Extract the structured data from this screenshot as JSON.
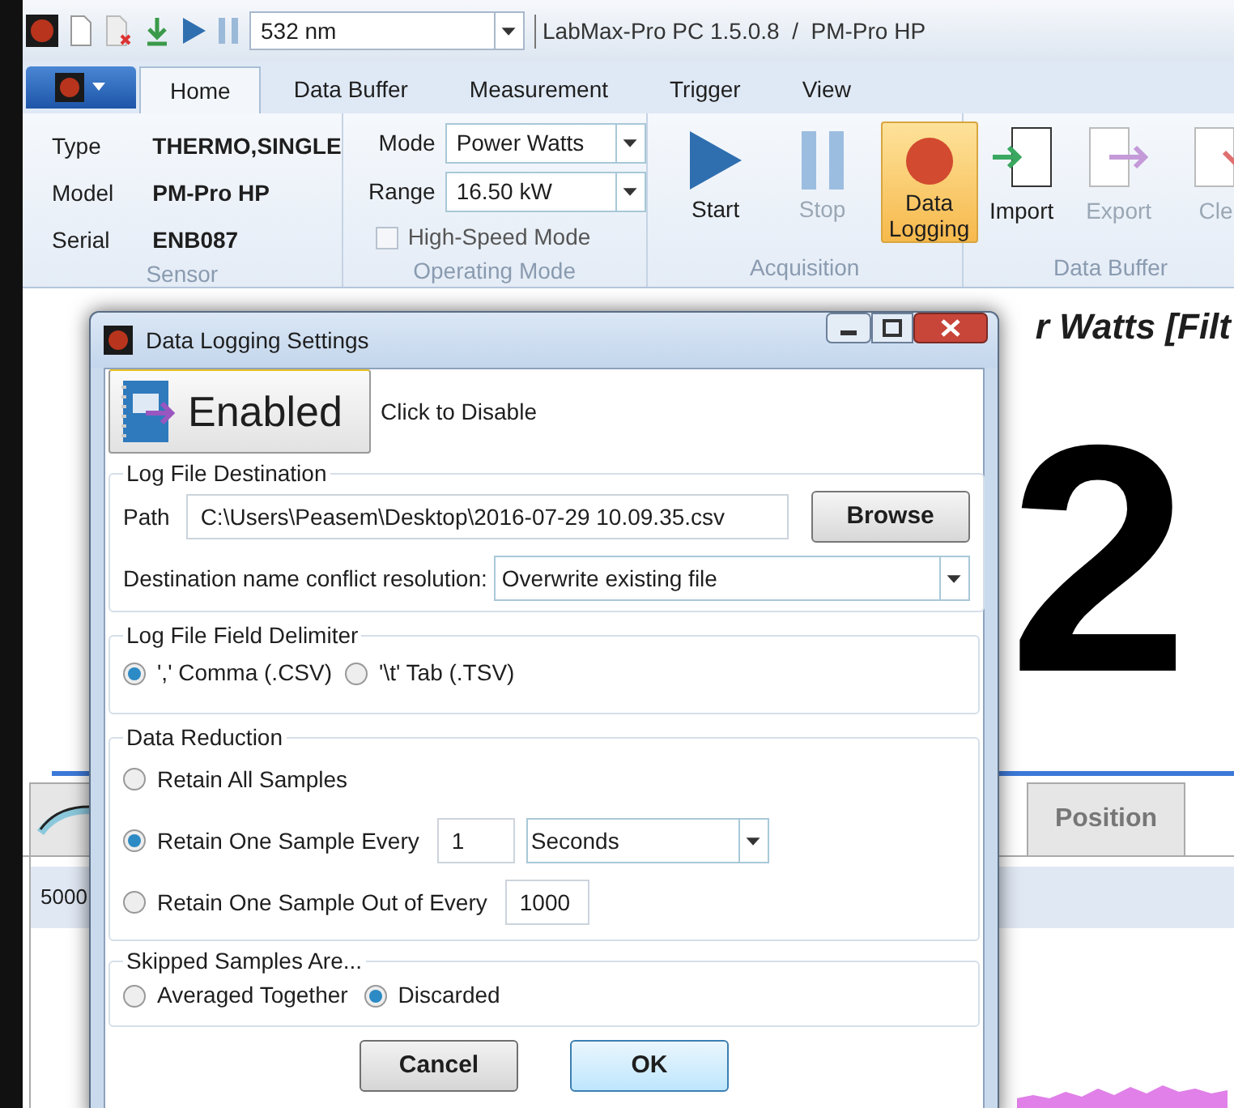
{
  "quick_access": {
    "wavelength": "532 nm"
  },
  "window": {
    "title": "LabMax-Pro PC 1.5.0.8  /  PM-Pro HP"
  },
  "tabs": [
    {
      "label": "Home",
      "selected": true
    },
    {
      "label": "Data Buffer",
      "selected": false
    },
    {
      "label": "Measurement",
      "selected": false
    },
    {
      "label": "Trigger",
      "selected": false
    },
    {
      "label": "View",
      "selected": false
    }
  ],
  "sensor": {
    "caption": "Sensor",
    "fields": [
      {
        "label": "Type",
        "value": "THERMO,SINGLE"
      },
      {
        "label": "Model",
        "value": "PM-Pro HP"
      },
      {
        "label": "Serial",
        "value": "ENB087"
      }
    ]
  },
  "operating_mode": {
    "caption": "Operating Mode",
    "selects": [
      {
        "label": "Mode",
        "value": "Power Watts"
      },
      {
        "label": "Range",
        "value": "16.50 kW"
      }
    ],
    "high_speed": {
      "label": "High-Speed Mode",
      "checked": false
    }
  },
  "acquisition": {
    "caption": "Acquisition",
    "buttons": [
      {
        "kind": "start",
        "label": "Start",
        "disabled": false,
        "selected": false
      },
      {
        "kind": "stop",
        "label": "Stop",
        "disabled": true,
        "selected": false
      },
      {
        "kind": "record",
        "label": "Data Logging",
        "disabled": false,
        "selected": true
      }
    ]
  },
  "data_buffer": {
    "caption": "Data Buffer",
    "buttons": [
      {
        "kind": "import",
        "label": "Import",
        "disabled": false
      },
      {
        "kind": "export",
        "label": "Export",
        "disabled": true
      },
      {
        "kind": "clear",
        "label": "Cle",
        "disabled": true
      }
    ]
  },
  "display": {
    "heading": "r Watts [Filt",
    "reading": "2",
    "bottom_tabs": [
      {
        "kind": "icon",
        "selected": false
      },
      {
        "kind": "text",
        "label": "Position",
        "selected": false
      }
    ],
    "chart_label": "5000"
  },
  "dialog": {
    "title": "Data Logging Settings",
    "toggle": {
      "label": "Enabled",
      "on": true,
      "hint": "Click to Disable"
    },
    "destination": {
      "legend": "Log File Destination",
      "path_label": "Path",
      "path": "C:\\Users\\Peasem\\Desktop\\2016-07-29 10.09.35.csv",
      "browse": "Browse",
      "conflict_label": "Destination name conflict resolution:",
      "conflict_value": "Overwrite existing file"
    },
    "delimiter": {
      "legend": "Log File Field Delimiter",
      "options": [
        {
          "label": "',' Comma (.CSV)",
          "selected": true
        },
        {
          "label": "'\\t' Tab (.TSV)",
          "selected": false
        }
      ]
    },
    "reduction": {
      "legend": "Data Reduction",
      "options": [
        {
          "kind": "plain",
          "label": "Retain All Samples",
          "selected": false
        },
        {
          "kind": "interval",
          "label": "Retain One Sample Every",
          "selected": true,
          "value": "1",
          "unit": "Seconds"
        },
        {
          "kind": "count",
          "label": "Retain One Sample Out of Every",
          "selected": false,
          "value": "1000"
        }
      ]
    },
    "skipped": {
      "legend": "Skipped Samples Are...",
      "options": [
        {
          "label": "Averaged Together",
          "selected": false
        },
        {
          "label": "Discarded",
          "selected": true
        }
      ]
    },
    "buttons": [
      {
        "kind": "cancel",
        "label": "Cancel"
      },
      {
        "kind": "ok",
        "label": "OK"
      }
    ]
  }
}
